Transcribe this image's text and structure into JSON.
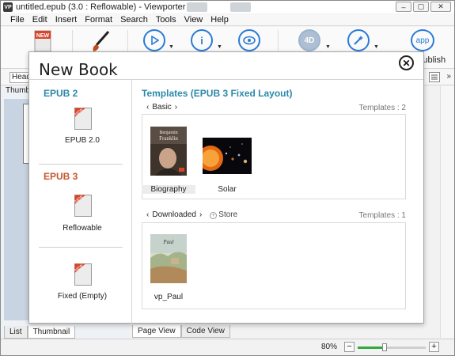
{
  "window": {
    "title": "untitled.epub (3.0 : Reflowable) - Viewporter",
    "logo": "VP",
    "controls": [
      "–",
      "▢",
      "✕"
    ]
  },
  "menu": [
    "File",
    "Edit",
    "Insert",
    "Format",
    "Search",
    "Tools",
    "View",
    "Help"
  ],
  "toolbar": {
    "publish_label": "Publish",
    "app_label": "app",
    "info_glyph": "i",
    "fourd_label": "4D",
    "partial_label_left": "N"
  },
  "toolbar2": {
    "style_value": "Head"
  },
  "left_panel": {
    "header": "Thumb",
    "tabs": [
      "List",
      "Thumbnail"
    ]
  },
  "center_tabs": [
    "Page View",
    "Code View"
  ],
  "status": {
    "zoom": "80%",
    "minus": "−",
    "plus": "+",
    "zoom_fraction": 0.4
  },
  "dialog": {
    "title": "New Book",
    "close_glyph": "✕",
    "epub2_header": "EPUB 2",
    "epub2_item": "EPUB 2.0",
    "epub3_header": "EPUB 3",
    "epub3_items": [
      "Reflowable",
      "Fixed (Empty)"
    ],
    "templates_title": "Templates (EPUB 3 Fixed Layout)",
    "basic": {
      "label": "Basic",
      "count": "Templates : 2",
      "items": [
        "Biography",
        "Solar"
      ]
    },
    "downloaded": {
      "label": "Downloaded",
      "store": "Store",
      "count": "Templates : 1",
      "items": [
        "vp_Paul"
      ]
    },
    "biography_cover_text": [
      "Benjamin",
      "Franklin"
    ],
    "paul_cover_text": "Paul",
    "badge_text": "NEW"
  },
  "colors": {
    "accent_blue": "#2b7bd6",
    "epub2_teal": "#2b8aa8",
    "epub3_orange": "#c8562c",
    "badge_red": "#d9442b",
    "zoom_green": "#2faa3f"
  }
}
